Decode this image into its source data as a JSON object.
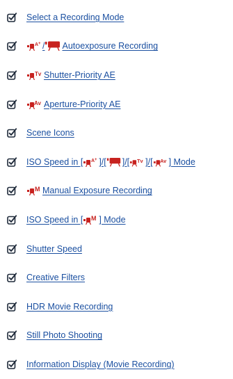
{
  "colors": {
    "link": "#1a4fa0",
    "icon": "#1f2a3a"
  },
  "check_icon": "checkbox-edit-icon",
  "items": [
    {
      "label": "Select a Recording Mode",
      "icons": []
    },
    {
      "label": " Autoexposure Recording",
      "icons": [
        "movie-auto-plus-icon",
        "movie-camera-icon"
      ],
      "separator": "/"
    },
    {
      "label": " Shutter-Priority AE",
      "icons": [
        "movie-tv-icon"
      ]
    },
    {
      "label": " Aperture-Priority AE",
      "icons": [
        "movie-av-icon"
      ]
    },
    {
      "label": "Scene Icons",
      "icons": []
    },
    {
      "label": "ISO Speed in [",
      "suffix": "] Mode",
      "icons": [
        "movie-auto-plus-icon",
        "movie-camera-icon",
        "movie-tv-icon",
        "movie-av-icon"
      ],
      "separator": "]/["
    },
    {
      "label": " Manual Exposure Recording",
      "icons": [
        "movie-m-icon"
      ]
    },
    {
      "label": "ISO Speed in [",
      "suffix": "] Mode",
      "icons": [
        "movie-m-icon"
      ]
    },
    {
      "label": "Shutter Speed",
      "icons": []
    },
    {
      "label": "Creative Filters",
      "icons": []
    },
    {
      "label": "HDR Movie Recording",
      "icons": []
    },
    {
      "label": "Still Photo Shooting",
      "icons": []
    },
    {
      "label": "Information Display (Movie Recording)",
      "icons": []
    }
  ]
}
